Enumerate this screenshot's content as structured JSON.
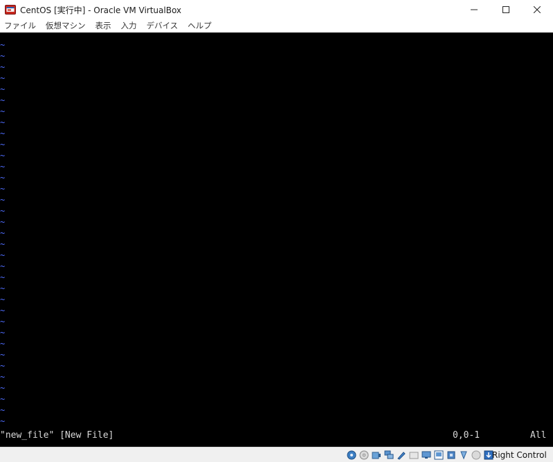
{
  "window": {
    "title": "CentOS [実行中] - Oracle VM VirtualBox"
  },
  "menubar": {
    "items": [
      {
        "label": "ファイル"
      },
      {
        "label": "仮想マシン"
      },
      {
        "label": "表示"
      },
      {
        "label": "入力"
      },
      {
        "label": "デバイス"
      },
      {
        "label": "ヘルプ"
      }
    ]
  },
  "terminal": {
    "tilde_char": "~",
    "status_file": "\"new_file\" [New File]",
    "status_position": "0,0-1",
    "status_scroll": "All"
  },
  "statusbar": {
    "host_key_label": "Right Control",
    "icons": [
      "hard-disk-icon",
      "optical-drive-icon",
      "audio-icon",
      "network-icon",
      "usb-icon",
      "shared-folders-icon",
      "display-icon",
      "video-capture-icon",
      "cpu-icon",
      "mouse-integration-icon",
      "host-key-icon"
    ]
  },
  "colors": {
    "terminal_bg": "#000000",
    "tilde": "#4f6dff",
    "status_text": "#d9d9d9"
  }
}
